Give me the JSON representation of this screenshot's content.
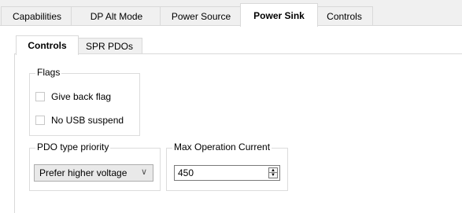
{
  "outer_tabs": [
    {
      "label": "Capabilities"
    },
    {
      "label": "DP Alt Mode"
    },
    {
      "label": "Power Source"
    },
    {
      "label": "Power Sink"
    },
    {
      "label": "Controls"
    }
  ],
  "inner_tabs": [
    {
      "label": "Controls"
    },
    {
      "label": "SPR PDOs"
    }
  ],
  "flags_group": {
    "title": "Flags",
    "give_back_label": "Give back flag",
    "give_back_checked": false,
    "no_usb_suspend_label": "No USB suspend",
    "no_usb_suspend_checked": false
  },
  "pdo_group": {
    "title": "PDO type priority",
    "selected": "Prefer higher voltage",
    "chevron_icon": "chevron-down-icon"
  },
  "current_group": {
    "title": "Max Operation Current",
    "value": "450"
  }
}
